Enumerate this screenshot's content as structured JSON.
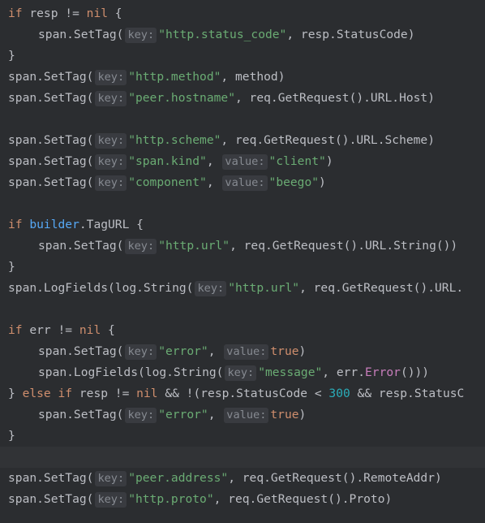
{
  "editor": {
    "language": "Go",
    "colors": {
      "background": "#2b2d30",
      "keyword": "#cf8e6d",
      "string": "#6aab73",
      "number": "#2aacb8",
      "field": "#c77dbb",
      "function": "#56a8f5",
      "inlay_hint": "#868a91"
    },
    "lines": [
      {
        "indent": 0,
        "tokens": [
          {
            "t": "if ",
            "c": "kw"
          },
          {
            "t": "resp != ",
            "c": "plain"
          },
          {
            "t": "nil",
            "c": "kw"
          },
          {
            "t": " {",
            "c": "plain"
          }
        ]
      },
      {
        "indent": 1,
        "tokens": [
          {
            "t": "span.SetTag(",
            "c": "plain"
          },
          {
            "t": "key:",
            "c": "hint"
          },
          {
            "t": "\"http.status_code\"",
            "c": "str"
          },
          {
            "t": ", resp.StatusCode)",
            "c": "plain"
          }
        ]
      },
      {
        "indent": 0,
        "tokens": [
          {
            "t": "}",
            "c": "plain"
          }
        ]
      },
      {
        "indent": 0,
        "tokens": [
          {
            "t": "span.SetTag(",
            "c": "plain"
          },
          {
            "t": "key:",
            "c": "hint"
          },
          {
            "t": "\"http.method\"",
            "c": "str"
          },
          {
            "t": ", method)",
            "c": "plain"
          }
        ]
      },
      {
        "indent": 0,
        "tokens": [
          {
            "t": "span.SetTag(",
            "c": "plain"
          },
          {
            "t": "key:",
            "c": "hint"
          },
          {
            "t": "\"peer.hostname\"",
            "c": "str"
          },
          {
            "t": ", req.GetRequest().URL.Host)",
            "c": "plain"
          }
        ]
      },
      {
        "indent": 0,
        "tokens": []
      },
      {
        "indent": 0,
        "tokens": [
          {
            "t": "span.SetTag(",
            "c": "plain"
          },
          {
            "t": "key:",
            "c": "hint"
          },
          {
            "t": "\"http.scheme\"",
            "c": "str"
          },
          {
            "t": ", req.GetRequest().URL.Scheme)",
            "c": "plain"
          }
        ]
      },
      {
        "indent": 0,
        "tokens": [
          {
            "t": "span.SetTag(",
            "c": "plain"
          },
          {
            "t": "key:",
            "c": "hint"
          },
          {
            "t": "\"span.kind\"",
            "c": "str"
          },
          {
            "t": ", ",
            "c": "plain"
          },
          {
            "t": "value:",
            "c": "hint"
          },
          {
            "t": "\"client\"",
            "c": "str"
          },
          {
            "t": ")",
            "c": "plain"
          }
        ]
      },
      {
        "indent": 0,
        "tokens": [
          {
            "t": "span.SetTag(",
            "c": "plain"
          },
          {
            "t": "key:",
            "c": "hint"
          },
          {
            "t": "\"component\"",
            "c": "str"
          },
          {
            "t": ", ",
            "c": "plain"
          },
          {
            "t": "value:",
            "c": "hint"
          },
          {
            "t": "\"beego\"",
            "c": "str"
          },
          {
            "t": ")",
            "c": "plain"
          }
        ]
      },
      {
        "indent": 0,
        "tokens": []
      },
      {
        "indent": 0,
        "tokens": [
          {
            "t": "if ",
            "c": "kw"
          },
          {
            "t": "builder",
            "c": "fn"
          },
          {
            "t": ".TagURL {",
            "c": "plain"
          }
        ]
      },
      {
        "indent": 1,
        "tokens": [
          {
            "t": "span.SetTag(",
            "c": "plain"
          },
          {
            "t": "key:",
            "c": "hint"
          },
          {
            "t": "\"http.url\"",
            "c": "str"
          },
          {
            "t": ", req.GetRequest().URL.String())",
            "c": "plain"
          }
        ]
      },
      {
        "indent": 0,
        "tokens": [
          {
            "t": "}",
            "c": "plain"
          }
        ]
      },
      {
        "indent": 0,
        "tokens": [
          {
            "t": "span.LogFields(log.String(",
            "c": "plain"
          },
          {
            "t": "key:",
            "c": "hint"
          },
          {
            "t": "\"http.url\"",
            "c": "str"
          },
          {
            "t": ", req.GetRequest().URL.",
            "c": "plain"
          }
        ]
      },
      {
        "indent": 0,
        "tokens": []
      },
      {
        "indent": 0,
        "tokens": [
          {
            "t": "if ",
            "c": "kw"
          },
          {
            "t": "err != ",
            "c": "plain"
          },
          {
            "t": "nil",
            "c": "kw"
          },
          {
            "t": " {",
            "c": "plain"
          }
        ]
      },
      {
        "indent": 1,
        "tokens": [
          {
            "t": "span.SetTag(",
            "c": "plain"
          },
          {
            "t": "key:",
            "c": "hint"
          },
          {
            "t": "\"error\"",
            "c": "str"
          },
          {
            "t": ", ",
            "c": "plain"
          },
          {
            "t": "value:",
            "c": "hint"
          },
          {
            "t": "true",
            "c": "kw"
          },
          {
            "t": ")",
            "c": "plain"
          }
        ]
      },
      {
        "indent": 1,
        "tokens": [
          {
            "t": "span.LogFields(log.String(",
            "c": "plain"
          },
          {
            "t": "key:",
            "c": "hint"
          },
          {
            "t": "\"message\"",
            "c": "str"
          },
          {
            "t": ", err.",
            "c": "plain"
          },
          {
            "t": "Error",
            "c": "field"
          },
          {
            "t": "()))",
            "c": "plain"
          }
        ]
      },
      {
        "indent": 0,
        "tokens": [
          {
            "t": "} ",
            "c": "plain"
          },
          {
            "t": "else if ",
            "c": "kw"
          },
          {
            "t": "resp != ",
            "c": "plain"
          },
          {
            "t": "nil",
            "c": "kw"
          },
          {
            "t": " && !(resp.StatusCode < ",
            "c": "plain"
          },
          {
            "t": "300",
            "c": "num"
          },
          {
            "t": " && resp.StatusC",
            "c": "plain"
          }
        ]
      },
      {
        "indent": 1,
        "tokens": [
          {
            "t": "span.SetTag(",
            "c": "plain"
          },
          {
            "t": "key:",
            "c": "hint"
          },
          {
            "t": "\"error\"",
            "c": "str"
          },
          {
            "t": ", ",
            "c": "plain"
          },
          {
            "t": "value:",
            "c": "hint"
          },
          {
            "t": "true",
            "c": "kw"
          },
          {
            "t": ")",
            "c": "plain"
          }
        ]
      },
      {
        "indent": 0,
        "tokens": [
          {
            "t": "}",
            "c": "plain"
          }
        ]
      },
      {
        "indent": 0,
        "current": true,
        "tokens": []
      },
      {
        "indent": 0,
        "tokens": [
          {
            "t": "span.SetTag(",
            "c": "plain"
          },
          {
            "t": "key:",
            "c": "hint"
          },
          {
            "t": "\"peer.address\"",
            "c": "str"
          },
          {
            "t": ", req.GetRequest().RemoteAddr)",
            "c": "plain"
          }
        ]
      },
      {
        "indent": 0,
        "tokens": [
          {
            "t": "span.SetTag(",
            "c": "plain"
          },
          {
            "t": "key:",
            "c": "hint"
          },
          {
            "t": "\"http.proto\"",
            "c": "str"
          },
          {
            "t": ", req.GetRequest().Proto)",
            "c": "plain"
          }
        ]
      }
    ]
  }
}
